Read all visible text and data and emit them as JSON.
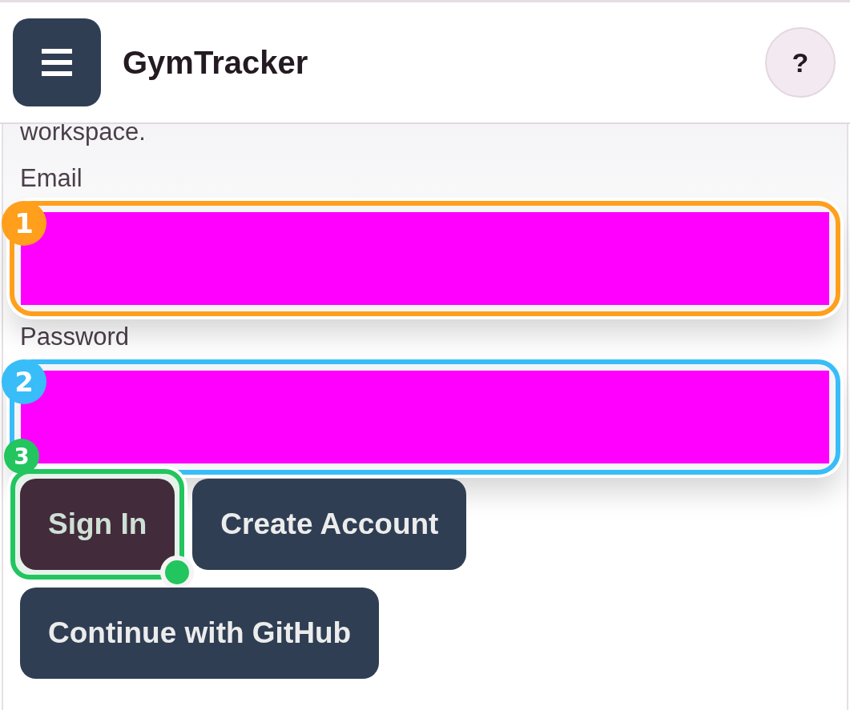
{
  "header": {
    "title": "GymTracker",
    "help": "?"
  },
  "intro_text": "workspace.",
  "fields": [
    {
      "label": "Email",
      "annotation": {
        "number": "1",
        "color": "#ff9f1c"
      }
    },
    {
      "label": "Password",
      "annotation": {
        "number": "2",
        "color": "#38bdf8"
      }
    }
  ],
  "buttons": [
    {
      "label": "Sign In",
      "pressed": true,
      "tap": true,
      "annotation": {
        "number": "3",
        "color": "#22c55e"
      }
    },
    {
      "label": "Create Account",
      "pressed": false,
      "tap": false
    },
    {
      "label": "Continue with GitHub",
      "pressed": false,
      "tap": false
    }
  ]
}
